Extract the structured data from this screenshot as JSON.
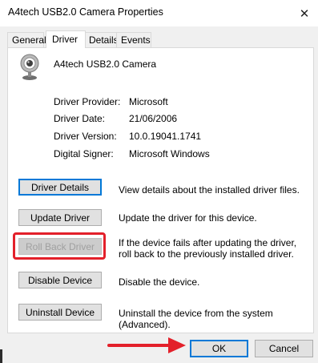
{
  "window": {
    "title": "A4tech USB2.0 Camera Properties",
    "close_glyph": "✕"
  },
  "tabs": [
    {
      "label": "General"
    },
    {
      "label": "Driver"
    },
    {
      "label": "Details"
    },
    {
      "label": "Events"
    }
  ],
  "device": {
    "name": "A4tech USB2.0 Camera",
    "icon": "webcam-icon"
  },
  "driver_info": [
    {
      "label": "Driver Provider:",
      "value": "Microsoft"
    },
    {
      "label": "Driver Date:",
      "value": "21/06/2006"
    },
    {
      "label": "Driver Version:",
      "value": "10.0.19041.1741"
    },
    {
      "label": "Digital Signer:",
      "value": "Microsoft Windows"
    }
  ],
  "actions": [
    {
      "label": "Driver Details",
      "description": "View details about the installed driver files."
    },
    {
      "label": "Update Driver",
      "description": "Update the driver for this device."
    },
    {
      "label": "Roll Back Driver",
      "description": "If the device fails after updating the driver, roll back to the previously installed driver."
    },
    {
      "label": "Disable Device",
      "description": "Disable the device."
    },
    {
      "label": "Uninstall Device",
      "description": "Uninstall the device from the system (Advanced)."
    }
  ],
  "footer": {
    "ok_label": "OK",
    "cancel_label": "Cancel"
  },
  "colors": {
    "annotation": "#e3202a",
    "focus": "#0078d7"
  }
}
